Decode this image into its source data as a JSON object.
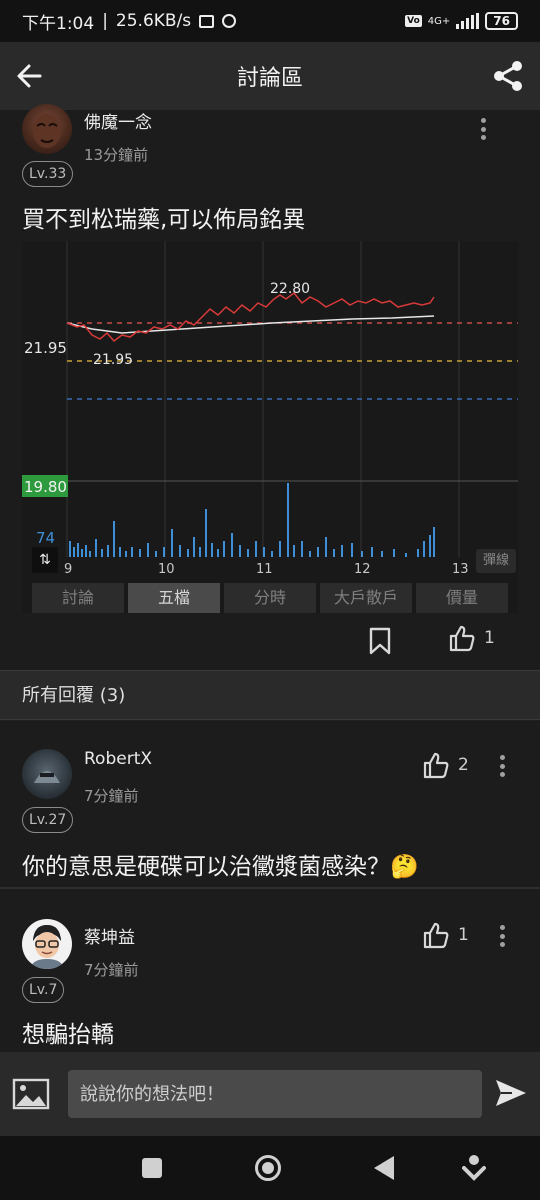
{
  "status": {
    "time": "下午1:04",
    "speed": "25.6KB/s",
    "network": "4G+",
    "battery": "76"
  },
  "app_bar": {
    "title": "討論區"
  },
  "post": {
    "author": "佛魔一念",
    "time": "13分鐘前",
    "level": "Lv.33",
    "text": "買不到松瑞藥,可以佈局銘異",
    "like_count": "1",
    "chart": {
      "price_labels": {
        "ref_left": "21.95",
        "ref_inline": "21.95",
        "high": "22.80",
        "low": "19.80",
        "volume": "74"
      },
      "x_ticks": [
        "9",
        "10",
        "11",
        "12",
        "13"
      ],
      "float_label": "彈線",
      "tabs": [
        "討論",
        "五檔",
        "分時",
        "大戶散戶",
        "價量"
      ],
      "active_tab": "五檔",
      "colors": {
        "price_line": "#d83a3a",
        "avg_line": "#e6e6e6",
        "volume": "#3f8fd8",
        "low_badge": "#2e9a3e"
      }
    }
  },
  "replies_header": "所有回覆 (3)",
  "replies": [
    {
      "author": "RobertX",
      "time": "7分鐘前",
      "level": "Lv.27",
      "text": "你的意思是硬碟可以治黴漿菌感染？🤔",
      "likes": "2"
    },
    {
      "author": "蔡坤益",
      "time": "7分鐘前",
      "level": "Lv.7",
      "text": "想騙抬轎",
      "likes": "1"
    }
  ],
  "input": {
    "placeholder": "說說你的想法吧！"
  },
  "icons": {
    "back": "arrow-left-icon",
    "share": "share-icon",
    "more": "more-vertical-icon",
    "bookmark": "bookmark-icon",
    "like": "thumbs-up-icon",
    "image": "image-icon",
    "send": "send-icon"
  }
}
